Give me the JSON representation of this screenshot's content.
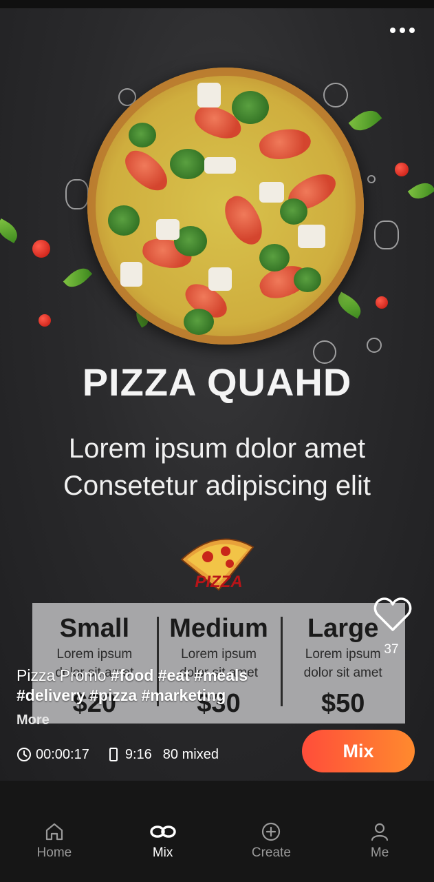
{
  "poster": {
    "title": "PIZZA QUAHD",
    "subtitle_line1": "Lorem ipsum dolor amet",
    "subtitle_line2": "Consetetur adipiscing elit",
    "logo_text": "PIZZA",
    "sizes": [
      {
        "name": "Small",
        "desc_line1": "Lorem ipsum",
        "desc_line2": "dolor sit amet",
        "price": "$20"
      },
      {
        "name": "Medium",
        "desc_line1": "Lorem ipsum",
        "desc_line2": "dolor sit amet",
        "price": "$30"
      },
      {
        "name": "Large",
        "desc_line1": "Lorem ipsum",
        "desc_line2": "dolor sit amet",
        "price": "$50"
      }
    ]
  },
  "likes": {
    "count": "37",
    "icon": "heart-icon"
  },
  "caption": {
    "text": "Pizza Promo",
    "tags_line1": "#food #eat #meals",
    "tags_line2": "#delivery #pizza #marketing",
    "more": "More"
  },
  "meta": {
    "duration": "00:00:17",
    "ratio": "9:16",
    "mixed": "80 mixed"
  },
  "mix_button": {
    "label": "Mix"
  },
  "nav": {
    "items": [
      {
        "label": "Home",
        "icon": "home-icon"
      },
      {
        "label": "Mix",
        "icon": "link-icon"
      },
      {
        "label": "Create",
        "icon": "plus-circle-icon"
      },
      {
        "label": "Me",
        "icon": "user-icon"
      }
    ],
    "active": "Mix"
  },
  "colors": {
    "accent_start": "#ff4d3a",
    "accent_end": "#ff8a2e",
    "nav_bg": "#161616",
    "nav_inactive": "#9a9a9a"
  }
}
